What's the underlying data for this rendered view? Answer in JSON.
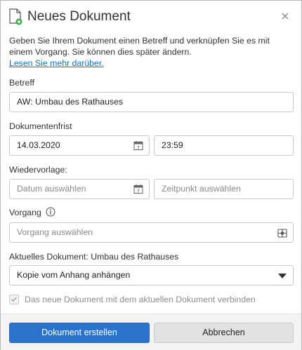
{
  "dialog": {
    "title": "Neues Dokument",
    "close_icon": "close-icon",
    "doc_icon": "new-document-icon"
  },
  "intro": {
    "text": "Geben Sie Ihrem Dokument einen Betreff und verknüpfen Sie es mit einem Vorgang. Sie können dies später ändern.",
    "link": "Lesen Sie mehr darüber."
  },
  "betreff": {
    "label": "Betreff",
    "value": "AW: Umbau des Rathauses"
  },
  "frist": {
    "label": "Dokumentenfrist",
    "date": "14.03.2020",
    "time": "23:59"
  },
  "wiedervorlage": {
    "label": "Wiedervorlage:",
    "date_placeholder": "Datum auswählen",
    "time_placeholder": "Zeitpunkt auswählen"
  },
  "vorgang": {
    "label": "Vorgang",
    "placeholder": "Vorgang auswählen"
  },
  "aktuell": {
    "label": "Aktuelles Dokument: Umbau des Rathauses",
    "selected": "Kopie vom Anhang anhängen"
  },
  "checkbox": {
    "label": "Das neue Dokument mit dem aktuellen Dokument verbinden",
    "checked": true
  },
  "buttons": {
    "create": "Dokument erstellen",
    "cancel": "Abbrechen"
  },
  "colors": {
    "primary": "#2a73cc",
    "link": "#1e6bb8",
    "icon_green": "#3aa84a"
  }
}
